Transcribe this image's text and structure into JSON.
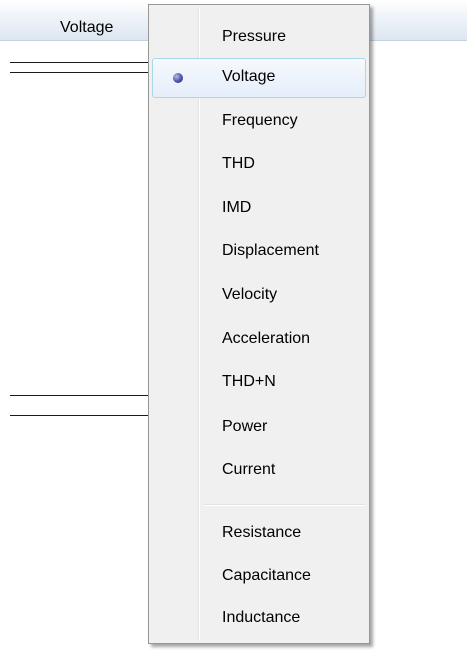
{
  "background": {
    "header_label": "Voltage"
  },
  "menu": {
    "selected_item": "Voltage",
    "group1": [
      {
        "label": "Pressure",
        "selected": false
      },
      {
        "label": "Voltage",
        "selected": true
      },
      {
        "label": "Frequency",
        "selected": false
      },
      {
        "label": "THD",
        "selected": false
      },
      {
        "label": "IMD",
        "selected": false
      },
      {
        "label": "Displacement",
        "selected": false
      },
      {
        "label": "Velocity",
        "selected": false
      },
      {
        "label": "Acceleration",
        "selected": false
      },
      {
        "label": "THD+N",
        "selected": false
      },
      {
        "label": "Power",
        "selected": false
      },
      {
        "label": "Current",
        "selected": false
      }
    ],
    "group2": [
      {
        "label": "Resistance",
        "selected": false
      },
      {
        "label": "Capacitance",
        "selected": false
      },
      {
        "label": "Inductance",
        "selected": false
      }
    ]
  },
  "colors": {
    "menu_background": "#f0f0f0",
    "highlight_border": "#a8d8eb",
    "radio_fill": "#4a52a6"
  }
}
